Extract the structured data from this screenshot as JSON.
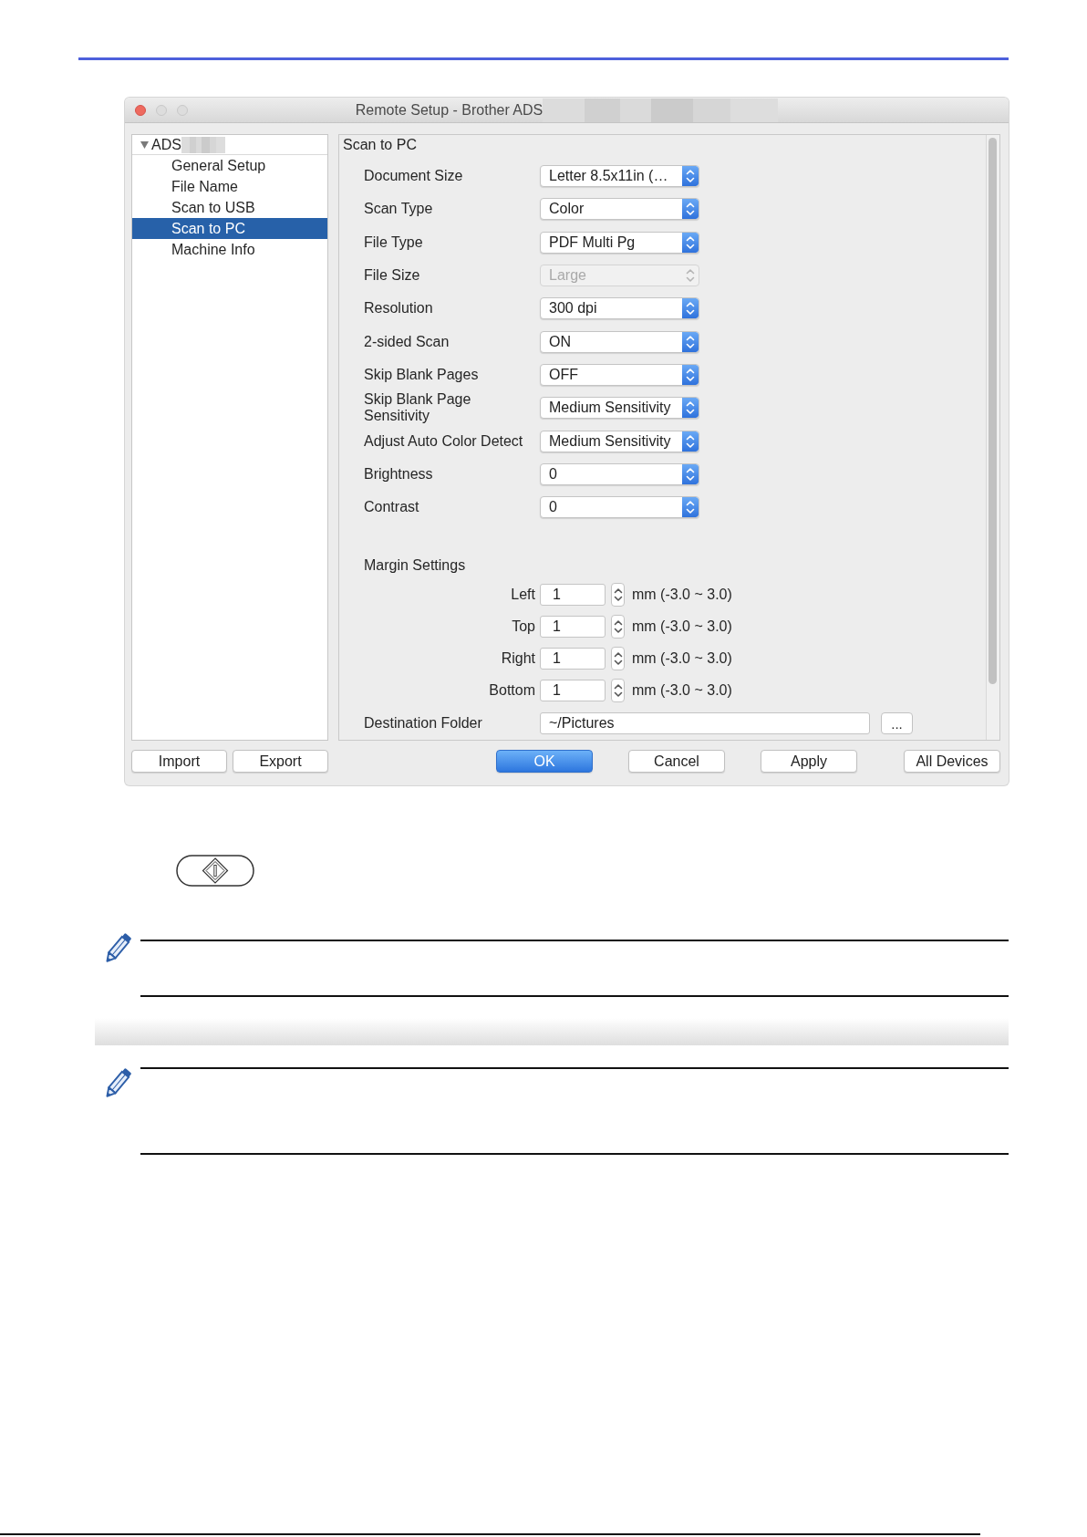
{
  "window": {
    "title": "Remote Setup - Brother ADS",
    "buttons": [
      {
        "kind": "close",
        "enabled": true
      },
      {
        "kind": "minimize",
        "enabled": false
      },
      {
        "kind": "zoom",
        "enabled": false
      }
    ]
  },
  "sidebar": {
    "tree": [
      {
        "label": "ADS",
        "expanded": true,
        "children": [
          {
            "label": "General Setup",
            "selected": false
          },
          {
            "label": "File Name",
            "selected": false
          },
          {
            "label": "Scan to USB",
            "selected": false
          },
          {
            "label": "Scan to PC",
            "selected": true
          },
          {
            "label": "Machine Info",
            "selected": false
          }
        ]
      }
    ],
    "buttons": [
      "Import",
      "Export"
    ]
  },
  "panel": {
    "title": "Scan to PC",
    "settings": [
      {
        "label": "Document Size",
        "value": "Letter 8.5x11in (…",
        "disabled": false
      },
      {
        "label": "Scan Type",
        "value": "Color",
        "disabled": false
      },
      {
        "label": "File Type",
        "value": "PDF Multi Pg",
        "disabled": false
      },
      {
        "label": "File Size",
        "value": "Large",
        "disabled": true
      },
      {
        "label": "Resolution",
        "value": "300 dpi",
        "disabled": false
      },
      {
        "label": "2-sided Scan",
        "value": "ON",
        "disabled": false
      },
      {
        "label": "Skip Blank Pages",
        "value": "OFF",
        "disabled": false
      },
      {
        "label": "Skip Blank Page Sensitivity",
        "value": "Medium Sensitivity",
        "disabled": false
      },
      {
        "label": "Adjust Auto Color Detect",
        "value": "Medium Sensitivity",
        "disabled": false
      },
      {
        "label": "Brightness",
        "value": "0",
        "disabled": false
      },
      {
        "label": "Contrast",
        "value": "0",
        "disabled": false
      }
    ],
    "margin_settings": {
      "title": "Margin Settings",
      "fields": [
        {
          "label": "Left",
          "value": "1",
          "range": "mm (-3.0 ~ 3.0)"
        },
        {
          "label": "Top",
          "value": "1",
          "range": "mm (-3.0 ~ 3.0)"
        },
        {
          "label": "Right",
          "value": "1",
          "range": "mm (-3.0 ~ 3.0)"
        },
        {
          "label": "Bottom",
          "value": "1",
          "range": "mm (-3.0 ~ 3.0)"
        }
      ]
    },
    "destination_folder": {
      "label": "Destination Folder",
      "value": "~/Pictures",
      "browse_button": "..."
    }
  },
  "buttons": [
    {
      "label": "OK",
      "default": true
    },
    {
      "label": "Cancel",
      "default": false
    },
    {
      "label": "Apply",
      "default": false
    },
    {
      "label": "All Devices",
      "default": false
    }
  ]
}
